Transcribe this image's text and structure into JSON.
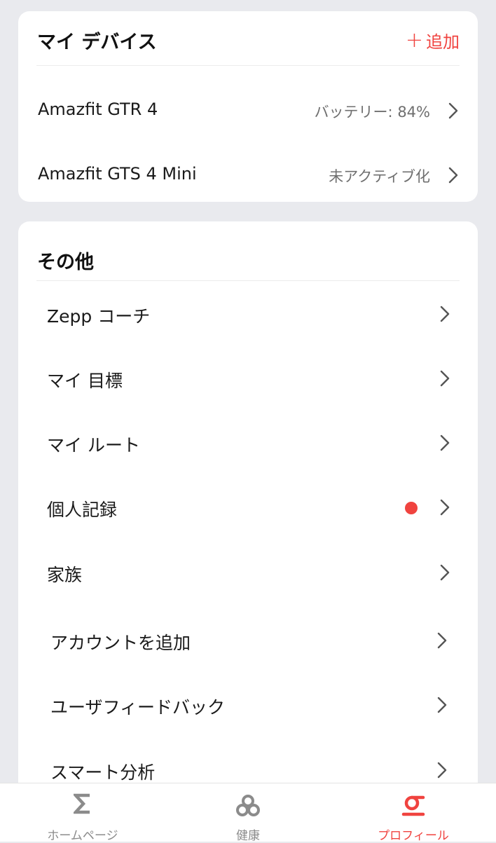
{
  "devices_card": {
    "title": "マイ デバイス",
    "add_label": "追加",
    "devices": [
      {
        "name": "Amazfit GTR 4",
        "status": "バッテリー: 84%"
      },
      {
        "name": "Amazfit GTS 4 Mini",
        "status": "未アクティブ化"
      }
    ]
  },
  "others_card": {
    "title": "その他",
    "items": [
      {
        "label": "Zepp コーチ"
      },
      {
        "label": "マイ 目標"
      },
      {
        "label": "マイ ルート"
      },
      {
        "label": "個人記録",
        "badge": "red-dot"
      },
      {
        "label": "家族"
      },
      {
        "label": "アカウントを追加"
      },
      {
        "label": "ユーザフィードバック"
      },
      {
        "label": "スマート分析"
      }
    ]
  },
  "tabbar": {
    "tabs": [
      {
        "label": "ホームページ",
        "icon": "sigma-icon"
      },
      {
        "label": "健康",
        "icon": "health-icon"
      },
      {
        "label": "プロフィール",
        "icon": "profile-icon",
        "active": true
      }
    ]
  },
  "colors": {
    "accent": "#f0433f",
    "background": "#e9eaee",
    "card": "#ffffff",
    "muted": "#6f6f6f"
  }
}
